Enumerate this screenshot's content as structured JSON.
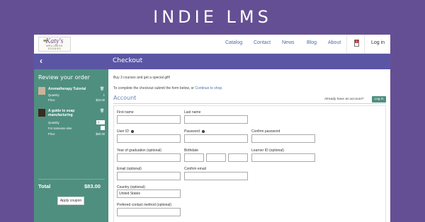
{
  "brand": "INDIE LMS",
  "logo": {
    "name": "Katy's",
    "line2": "WELLNESS",
    "line3": "GOODIES"
  },
  "nav": {
    "items": [
      "Catalog",
      "Contact",
      "News",
      "Blog",
      "About"
    ],
    "cart_count": "1",
    "login": "Log in"
  },
  "page_title": "Checkout",
  "sidebar": {
    "title": "Review your order",
    "items": [
      {
        "title": "Aromatherapy Tutorial",
        "quantity_label": "Quantity",
        "quantity": "1",
        "price_label": "Price",
        "price": "$23.00"
      },
      {
        "title": "A guide to soap manufacturing",
        "quantity_label": "Quantity",
        "quantity": "1",
        "someone_else_label": "For someone else",
        "price_label": "Price",
        "price": "$60.00"
      }
    ],
    "total_label": "Total",
    "total": "$83.00",
    "coupon_button": "Apply coupon"
  },
  "main": {
    "promo": "Buy 3 courses and get a special gift!",
    "instructions": "To complete the checkout submit the form below, or",
    "continue_link": "Continue to shop.",
    "account_title": "Account",
    "already_account": "Already have an account?",
    "login_button": "Log in"
  },
  "form": {
    "first_name": "First name",
    "last_name": "Last name",
    "user_id": "User ID",
    "password": "Password",
    "confirm_password": "Confirm password",
    "year_of_graduation": "Year of graduation (optional)",
    "birthdate": "Birthdate",
    "learner_id": "Learner ID (optional)",
    "email": "Email (optional)",
    "confirm_email": "Confirm email",
    "country_label": "Country (optional)",
    "country_value": "United States",
    "contact_method": "Prefered contact method (optional)"
  },
  "colors": {
    "background": "#654f94",
    "title_bar": "#5b56a3",
    "sidebar": "#4f8f80",
    "link": "#4a6fa8"
  }
}
